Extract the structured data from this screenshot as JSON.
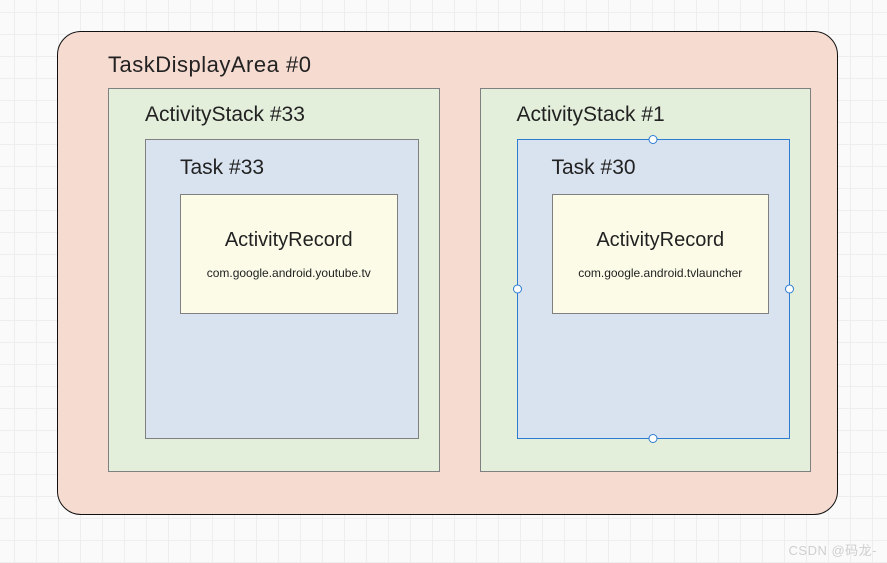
{
  "displayArea": {
    "title": "TaskDisplayArea #0",
    "stacks": [
      {
        "title": "ActivityStack #33",
        "task": {
          "title": "Task #33",
          "record": {
            "title": "ActivityRecord",
            "package": "com.google.android.youtube.tv"
          }
        },
        "selected": false
      },
      {
        "title": "ActivityStack #1",
        "task": {
          "title": "Task #30",
          "record": {
            "title": "ActivityRecord",
            "package": "com.google.android.tvlauncher"
          }
        },
        "selected": true
      }
    ]
  },
  "watermark": "CSDN @码龙-"
}
